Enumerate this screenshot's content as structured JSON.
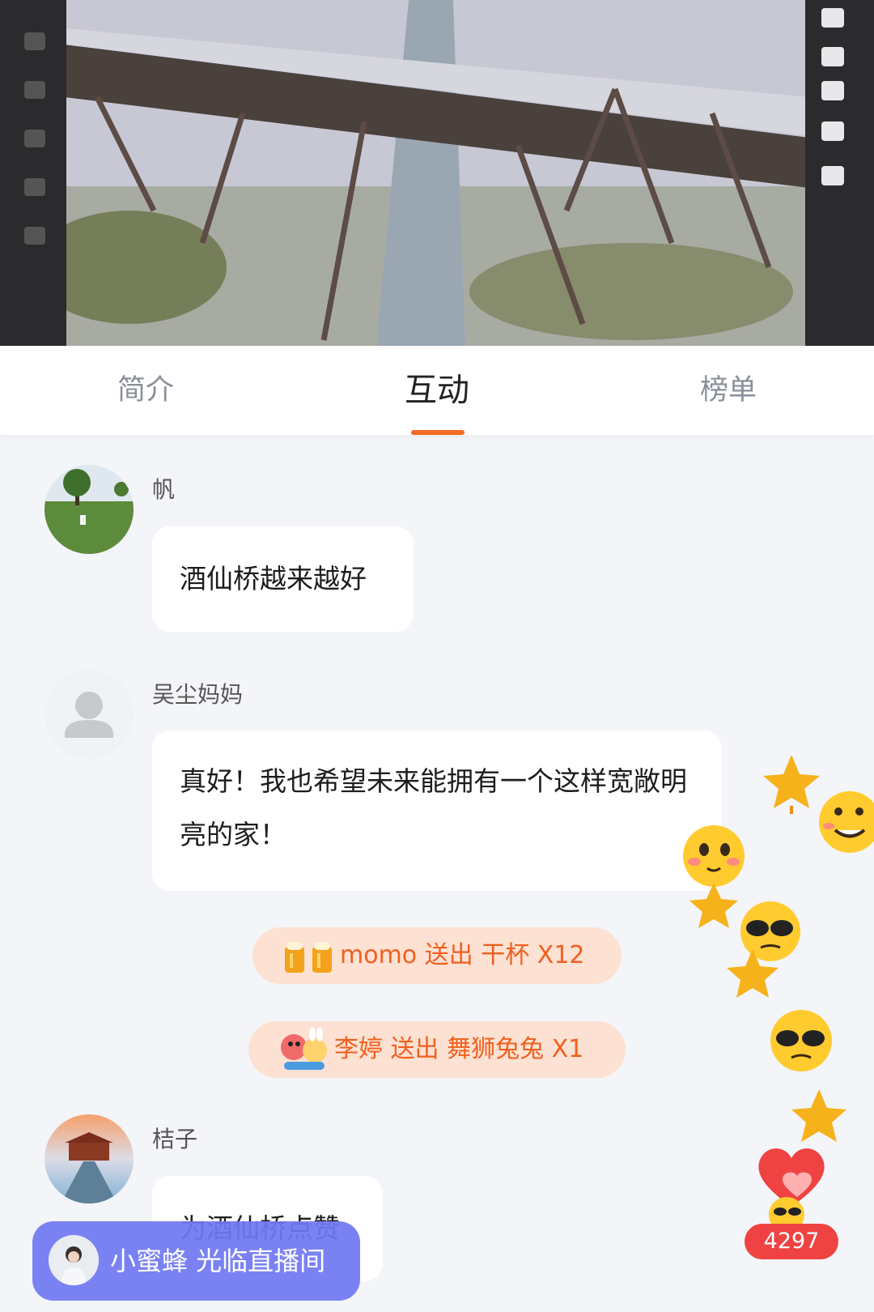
{
  "tabs": [
    {
      "label": "简介",
      "active": false
    },
    {
      "label": "互动",
      "active": true
    },
    {
      "label": "榜单",
      "active": false
    }
  ],
  "accent_color": "#f26b24",
  "comments": [
    {
      "username": "帆",
      "avatar": "landscape-avatar",
      "text": "酒仙桥越来越好"
    },
    {
      "username": "吴尘妈妈",
      "avatar": "default-user-avatar",
      "text": "真好！我也希望未来能拥有一个这样宽敞明亮的家！"
    },
    {
      "username": "桔子",
      "avatar": "pier-avatar",
      "text": "为酒仙桥点赞"
    }
  ],
  "gifts": [
    {
      "icon": "beer-cheers-icon",
      "text": "momo  送出  干杯  X12"
    },
    {
      "icon": "lion-dance-rabbit-icon",
      "text": "李婷  送出  舞狮兔兔  X1"
    }
  ],
  "likes": {
    "count": "4297",
    "icon": "heart-icon"
  },
  "join_banner": {
    "text": "小蜜蜂  光临直播间",
    "avatar": "user-avatar"
  }
}
